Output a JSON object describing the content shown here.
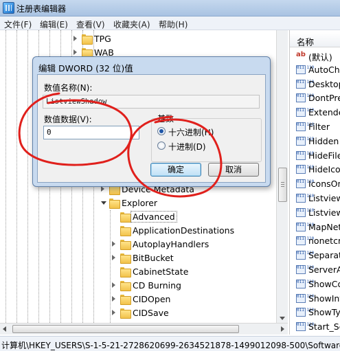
{
  "window": {
    "title": "注册表编辑器"
  },
  "menu": [
    "文件(F)",
    "编辑(E)",
    "查看(V)",
    "收藏夹(A)",
    "帮助(H)"
  ],
  "tree": {
    "top_items": [
      "TPG",
      "WAB"
    ],
    "items": [
      {
        "label": "Device Metadata",
        "expanded": false
      },
      {
        "label": "Explorer",
        "expanded": true
      },
      {
        "label": "Advanced",
        "expanded": false,
        "selected": true
      },
      {
        "label": "ApplicationDestinations",
        "expanded": false
      },
      {
        "label": "AutoplayHandlers",
        "expanded": false
      },
      {
        "label": "BitBucket",
        "expanded": false
      },
      {
        "label": "CabinetState",
        "expanded": false
      },
      {
        "label": "CD Burning",
        "expanded": false
      },
      {
        "label": "CIDOpen",
        "expanded": false
      },
      {
        "label": "CIDSave",
        "expanded": false
      }
    ]
  },
  "list": {
    "header": "名称",
    "rows": [
      {
        "icon": "string-value-icon",
        "name": "(默认)"
      },
      {
        "icon": "dword-value-icon",
        "name": "AutoChe"
      },
      {
        "icon": "dword-value-icon",
        "name": "Desktop"
      },
      {
        "icon": "dword-value-icon",
        "name": "DontPre"
      },
      {
        "icon": "dword-value-icon",
        "name": "Extende"
      },
      {
        "icon": "dword-value-icon",
        "name": "Filter"
      },
      {
        "icon": "dword-value-icon",
        "name": "Hidden"
      },
      {
        "icon": "dword-value-icon",
        "name": "HideFile"
      },
      {
        "icon": "dword-value-icon",
        "name": "HideIcon"
      },
      {
        "icon": "dword-value-icon",
        "name": "IconsOn"
      },
      {
        "icon": "dword-value-icon",
        "name": "Listview"
      },
      {
        "icon": "dword-value-icon",
        "name": "ListviewS"
      },
      {
        "icon": "dword-value-icon",
        "name": "MapNet"
      },
      {
        "icon": "dword-value-icon",
        "name": "nonetcra"
      },
      {
        "icon": "dword-value-icon",
        "name": "Separate"
      },
      {
        "icon": "dword-value-icon",
        "name": "ServerA"
      },
      {
        "icon": "dword-value-icon",
        "name": "ShowCo"
      },
      {
        "icon": "dword-value-icon",
        "name": "ShowInf"
      },
      {
        "icon": "dword-value-icon",
        "name": "ShowTyp"
      },
      {
        "icon": "dword-value-icon",
        "name": "Start_Se"
      }
    ]
  },
  "status": {
    "path": "计算机\\HKEY_USERS\\S-1-5-21-2728620699-2634521878-1499012098-500\\Software\\Mi"
  },
  "dialog": {
    "title": "编辑 DWORD (32 位)值",
    "name_label": "数值名称(N):",
    "name_value": "ListviewShadow",
    "data_label": "数值数据(V):",
    "data_value": "0",
    "base_label": "基数",
    "base_hex": "十六进制(H)",
    "base_dec": "十进制(D)",
    "base_selected": "hex",
    "ok": "确定",
    "cancel": "取消"
  },
  "colors": {
    "annotation": "#e0201c",
    "selection_radio": "#1e56a8"
  }
}
